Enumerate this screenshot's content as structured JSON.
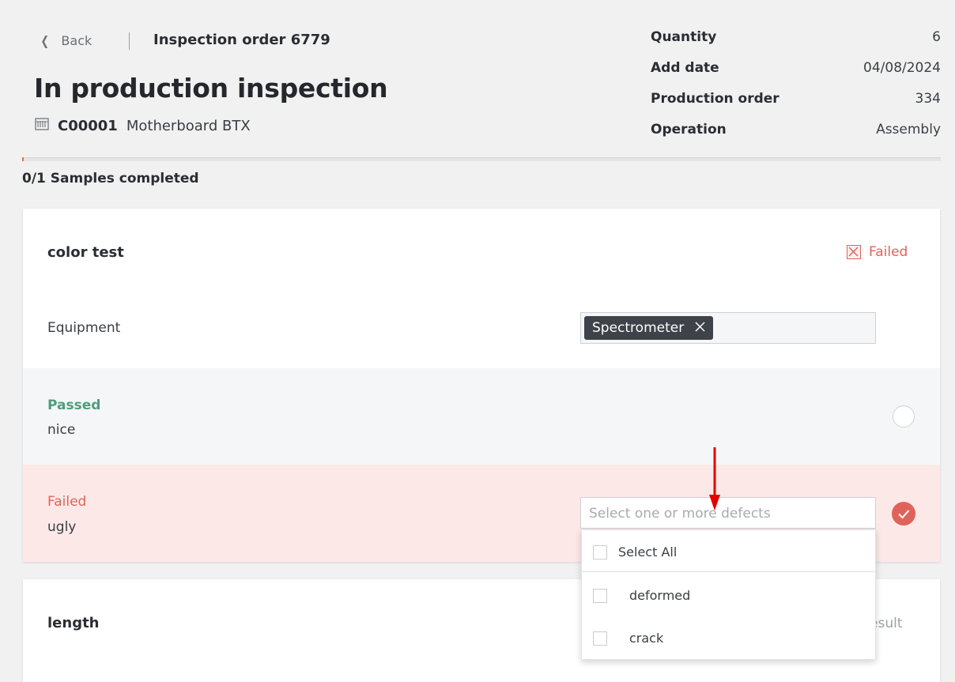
{
  "header": {
    "back_label": "Back",
    "order_title": "Inspection order 6779",
    "page_title": "In production inspection",
    "product_code": "C00001",
    "product_name": "Motherboard BTX"
  },
  "meta": [
    {
      "key": "Quantity",
      "value": "6"
    },
    {
      "key": "Add date",
      "value": "04/08/2024"
    },
    {
      "key": "Production order",
      "value": "334"
    },
    {
      "key": "Operation",
      "value": "Assembly"
    }
  ],
  "progress": {
    "text": "0/1 Samples completed",
    "fraction": 0.002
  },
  "test1": {
    "name": "color test",
    "status": "Failed",
    "equipment_label": "Equipment",
    "equipment_tag": "Spectrometer",
    "pass_option": {
      "title": "Passed",
      "desc": "nice"
    },
    "fail_option": {
      "title": "Failed",
      "desc": "ugly"
    },
    "defects_placeholder": "Select one or more defects"
  },
  "dropdown": {
    "select_all": "Select All",
    "options": [
      "deformed",
      "crack"
    ]
  },
  "test2": {
    "name": "length",
    "status_partial": "esult"
  },
  "colors": {
    "accent_orange": "#e8743b",
    "failed_red": "#e0635a",
    "passed_green": "#4f9e7b",
    "annotation_arrow": "#e60000"
  },
  "icons": [
    "chevron-left-icon",
    "component-chip-icon",
    "close-icon",
    "checkmark-icon"
  ]
}
